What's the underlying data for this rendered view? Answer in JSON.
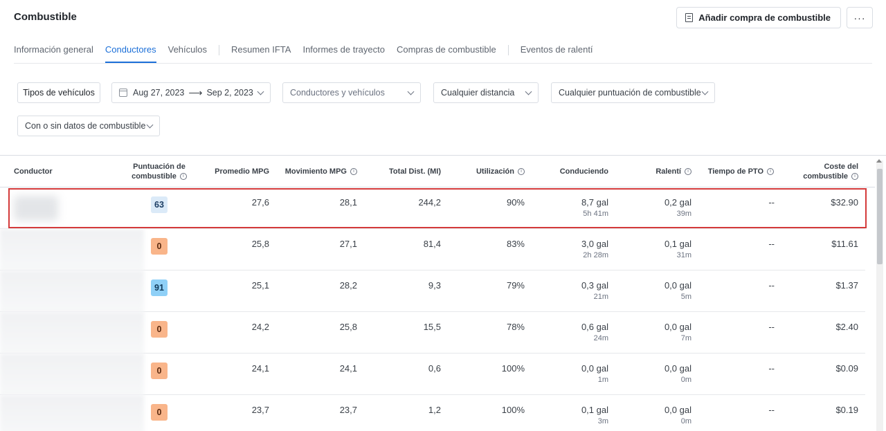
{
  "header": {
    "title": "Combustible",
    "add_purchase_label": "Añadir compra de combustible",
    "more_label": "···"
  },
  "tabs": [
    {
      "label": "Información general",
      "active": false
    },
    {
      "label": "Conductores",
      "active": true
    },
    {
      "label": "Vehículos",
      "active": false
    },
    {
      "label": "Resumen IFTA",
      "active": false
    },
    {
      "label": "Informes de trayecto",
      "active": false
    },
    {
      "label": "Compras de combustible",
      "active": false
    },
    {
      "label": "Eventos de ralentí",
      "active": false
    }
  ],
  "filters": {
    "vehicle_types": "Tipos de vehículos",
    "date_start": "Aug 27, 2023",
    "date_arrow": "⟶",
    "date_end": "Sep 2, 2023",
    "drivers_vehicles": "Conductores y vehículos",
    "distance": "Cualquier distancia",
    "fuel_score": "Cualquier puntuación de combustible",
    "fuel_data": "Con o sin datos de combustible"
  },
  "table": {
    "columns": {
      "driver": "Conductor",
      "score": "Puntuación de combustible",
      "avg_mpg": "Promedio MPG",
      "moving_mpg": "Movimiento MPG",
      "total_dist": "Total Dist. (MI)",
      "utilization": "Utilización",
      "driving": "Conduciendo",
      "idle": "Ralentí",
      "pto_time": "Tiempo de PTO",
      "fuel_cost": "Coste del combustible"
    },
    "rows": [
      {
        "score": "63",
        "score_level": "mid",
        "avg_mpg": "27,6",
        "moving_mpg": "28,1",
        "total_dist": "244,2",
        "utilization": "90%",
        "driving_gal": "8,7 gal",
        "driving_time": "5h 41m",
        "idle_gal": "0,2 gal",
        "idle_time": "39m",
        "pto": "--",
        "cost": "$32.90"
      },
      {
        "score": "0",
        "score_level": "low",
        "avg_mpg": "25,8",
        "moving_mpg": "27,1",
        "total_dist": "81,4",
        "utilization": "83%",
        "driving_gal": "3,0 gal",
        "driving_time": "2h 28m",
        "idle_gal": "0,1 gal",
        "idle_time": "31m",
        "pto": "--",
        "cost": "$11.61"
      },
      {
        "score": "91",
        "score_level": "high",
        "avg_mpg": "25,1",
        "moving_mpg": "28,2",
        "total_dist": "9,3",
        "utilization": "79%",
        "driving_gal": "0,3 gal",
        "driving_time": "21m",
        "idle_gal": "0,0 gal",
        "idle_time": "5m",
        "pto": "--",
        "cost": "$1.37"
      },
      {
        "score": "0",
        "score_level": "low",
        "avg_mpg": "24,2",
        "moving_mpg": "25,8",
        "total_dist": "15,5",
        "utilization": "78%",
        "driving_gal": "0,6 gal",
        "driving_time": "24m",
        "idle_gal": "0,0 gal",
        "idle_time": "7m",
        "pto": "--",
        "cost": "$2.40"
      },
      {
        "score": "0",
        "score_level": "low",
        "avg_mpg": "24,1",
        "moving_mpg": "24,1",
        "total_dist": "0,6",
        "utilization": "100%",
        "driving_gal": "0,0 gal",
        "driving_time": "1m",
        "idle_gal": "0,0 gal",
        "idle_time": "0m",
        "pto": "--",
        "cost": "$0.09"
      },
      {
        "score": "0",
        "score_level": "low",
        "avg_mpg": "23,7",
        "moving_mpg": "23,7",
        "total_dist": "1,2",
        "utilization": "100%",
        "driving_gal": "0,1 gal",
        "driving_time": "3m",
        "idle_gal": "0,0 gal",
        "idle_time": "0m",
        "pto": "--",
        "cost": "$0.19"
      }
    ]
  },
  "colors": {
    "accent": "#1b6fd8",
    "highlight_border": "#d43a3a",
    "score_low": "#f9b58a",
    "score_mid": "#dbeaf8",
    "score_high": "#8fd0f7"
  }
}
